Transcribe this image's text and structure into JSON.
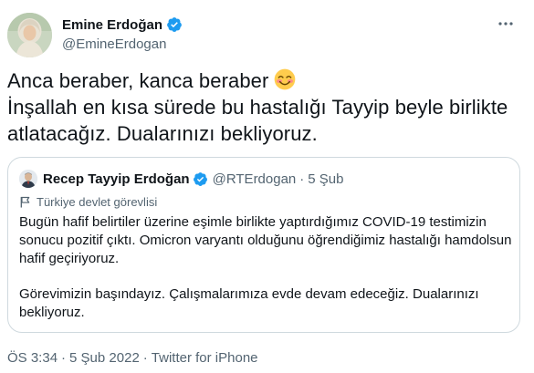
{
  "author": {
    "display_name": "Emine Erdoğan",
    "handle": "@EmineErdogan",
    "verified": true
  },
  "tweet": {
    "lines": [
      "Anca beraber, kanca beraber",
      "İnşallah en kısa sürede bu hastalığı Tayyip beyle birlikte",
      "atlatacağız. Dualarınızı bekliyoruz."
    ],
    "emoji": "smiling-face-with-smiling-eyes"
  },
  "quoted": {
    "display_name": "Recep Tayyip Erdoğan",
    "handle": "@RTErdogan",
    "separator": "·",
    "date": "5 Şub",
    "verified": true,
    "label": "Türkiye devlet görevlisi",
    "paragraphs": [
      "Bugün hafif belirtiler üzerine eşimle birlikte yaptırdığımız COVID-19 testimizin\nsonucu pozitif çıktı. Omicron varyantı olduğunu öğrendiğimiz hastalığı hamdolsun\nhafif geçiriyoruz.",
      "Görevimizin başındayız. Çalışmalarımıza evde devam edeceğiz. Dualarınızı\nbekliyoruz."
    ]
  },
  "meta": {
    "time": "ÖS 3:34",
    "separator": "·",
    "date": "5 Şub 2022",
    "source": "Twitter for iPhone"
  },
  "colors": {
    "text": "#0f1419",
    "secondary": "#536471",
    "verified": "#1d9bf0",
    "border": "#cfd9de"
  }
}
